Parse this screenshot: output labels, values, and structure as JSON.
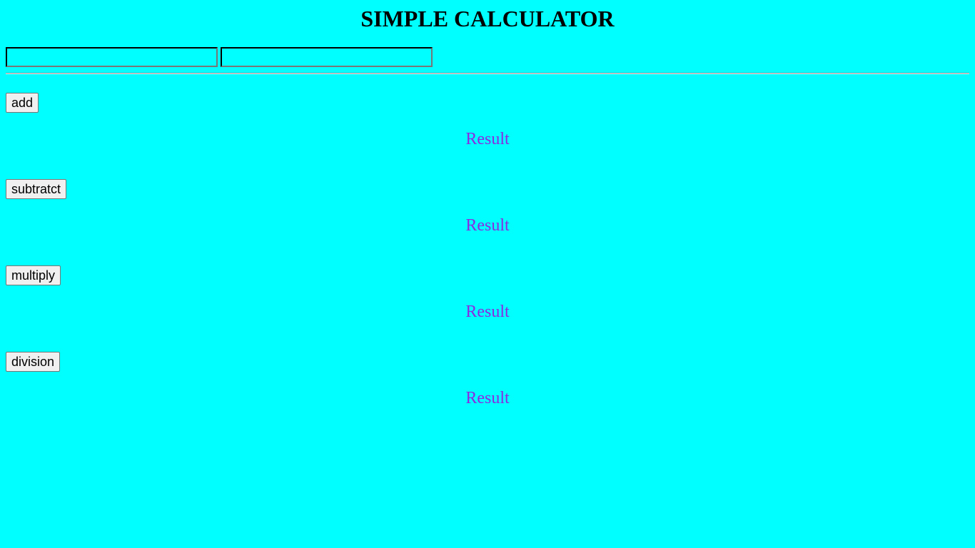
{
  "page": {
    "title": "SIMPLE CALCULATOR",
    "background_color": "#00ffff",
    "result_color": "#8a2be2"
  },
  "inputs": [
    {
      "value": "",
      "placeholder": ""
    },
    {
      "value": "",
      "placeholder": ""
    }
  ],
  "operations": [
    {
      "button_label": "add",
      "result_text": "Result"
    },
    {
      "button_label": "subtratct",
      "result_text": "Result"
    },
    {
      "button_label": "multiply",
      "result_text": "Result"
    },
    {
      "button_label": "division",
      "result_text": "Result"
    }
  ]
}
